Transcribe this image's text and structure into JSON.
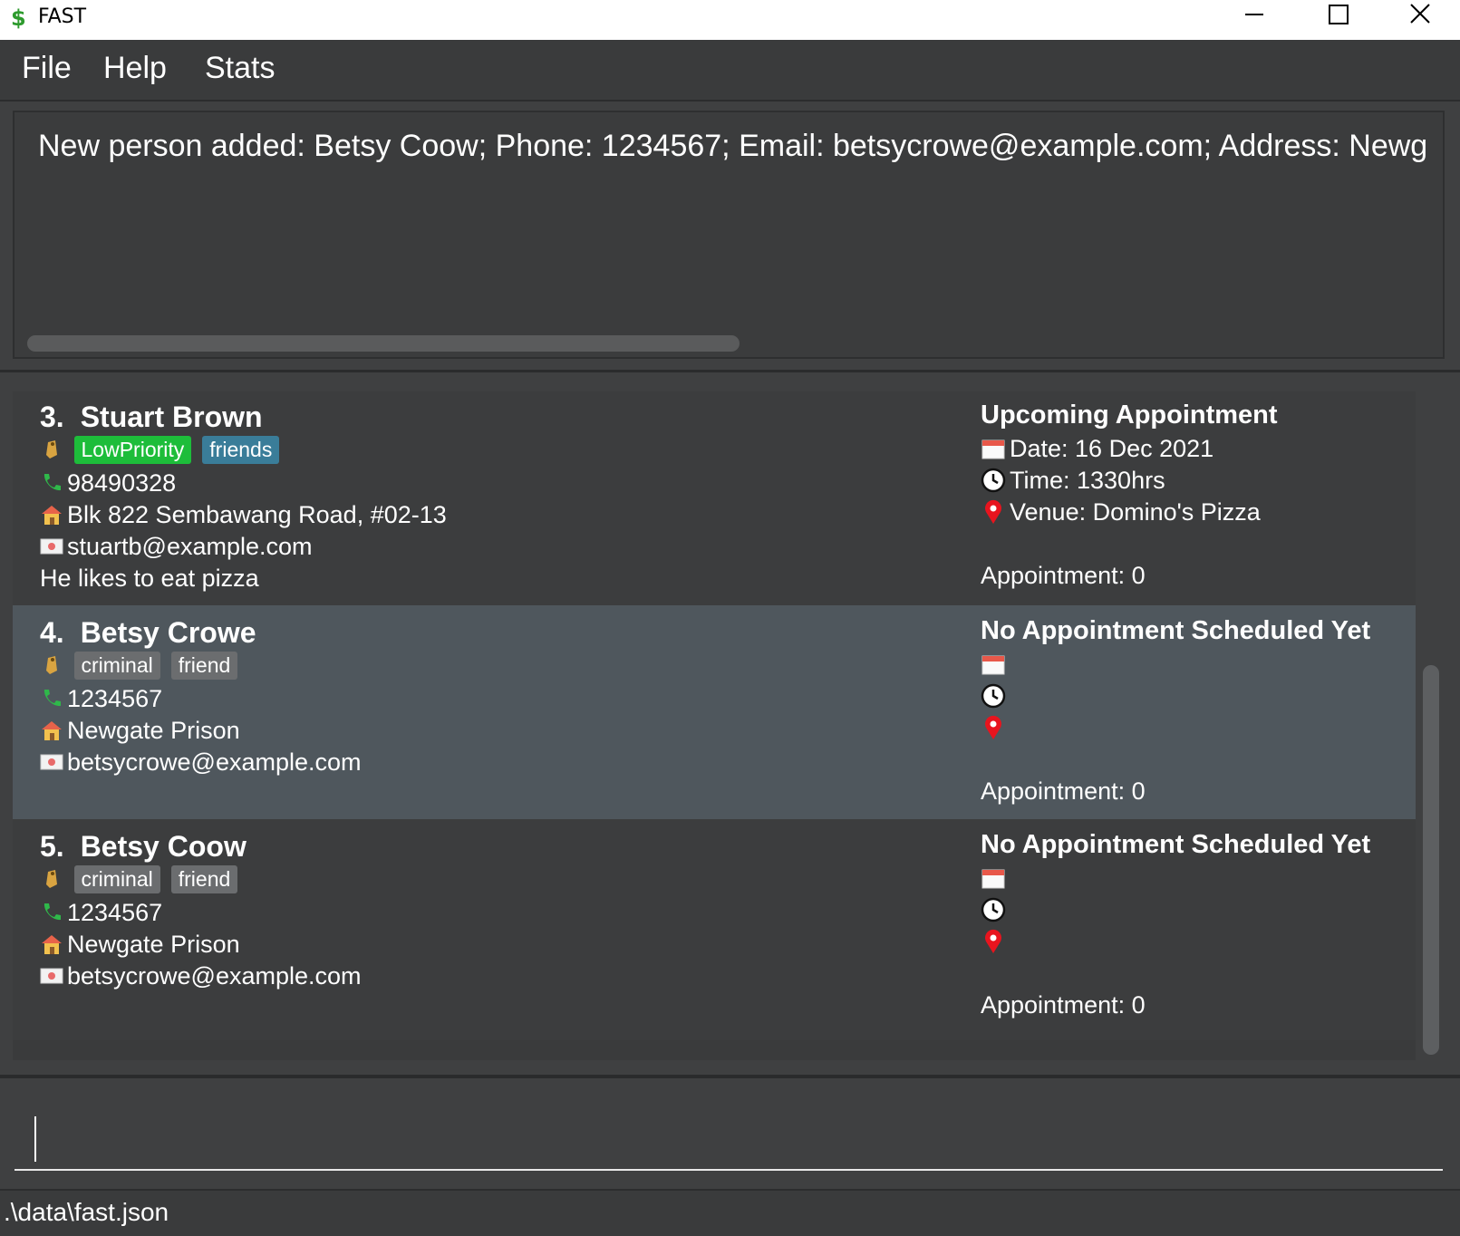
{
  "window": {
    "title": "FAST",
    "logo": "$"
  },
  "menu": {
    "items": [
      "File",
      "Help",
      "Stats"
    ]
  },
  "result": {
    "text": "New person added: Betsy Coow; Phone: 1234567; Email: betsycrowe@example.com; Address: Newg"
  },
  "contacts": [
    {
      "index": "3.",
      "name": "Stuart Brown",
      "tags": [
        {
          "label": "LowPriority",
          "color": "#1dbd3a"
        },
        {
          "label": "friends",
          "color": "#3a7d99"
        }
      ],
      "phone": "98490328",
      "address": "Blk 822 Sembawang Road, #02-13",
      "email": "stuartb@example.com",
      "remark": "He likes to eat pizza",
      "appointment": {
        "title": "Upcoming Appointment",
        "date": "Date: 16 Dec 2021",
        "time": "Time: 1330hrs",
        "venue": "Venue: Domino's Pizza",
        "count": "Appointment: 0"
      }
    },
    {
      "index": "4.",
      "name": "Betsy Crowe",
      "tags": [
        {
          "label": "criminal",
          "color": "#6b6d6f"
        },
        {
          "label": "friend",
          "color": "#6b6d6f"
        }
      ],
      "phone": "1234567",
      "address": "Newgate Prison",
      "email": "betsycrowe@example.com",
      "remark": "",
      "appointment": {
        "title": "No Appointment Scheduled Yet",
        "date": "",
        "time": "",
        "venue": "",
        "count": "Appointment: 0"
      }
    },
    {
      "index": "5.",
      "name": "Betsy Coow",
      "tags": [
        {
          "label": "criminal",
          "color": "#6b6d6f"
        },
        {
          "label": "friend",
          "color": "#6b6d6f"
        }
      ],
      "phone": "1234567",
      "address": "Newgate Prison",
      "email": "betsycrowe@example.com",
      "remark": "",
      "appointment": {
        "title": "No Appointment Scheduled Yet",
        "date": "",
        "time": "",
        "venue": "",
        "count": "Appointment: 0"
      }
    }
  ],
  "command": {
    "value": ""
  },
  "status": {
    "file_path": ".\\data\\fast.json"
  },
  "icons": {
    "tag": "tag-icon",
    "phone": "phone-icon",
    "address": "house-icon",
    "email": "envelope-icon",
    "date": "calendar-icon",
    "time": "clock-icon",
    "venue": "map-pin-icon"
  }
}
